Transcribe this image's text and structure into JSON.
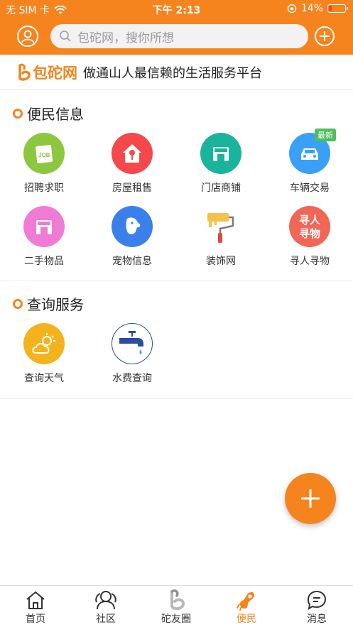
{
  "status": {
    "carrier": "无 SIM 卡",
    "time": "下午 2:13",
    "battery": "14%"
  },
  "search": {
    "placeholder": "包砣网，搜你所想"
  },
  "banner": {
    "logo": "包砣网",
    "tagline": "做通山人最信赖的生活服务平台"
  },
  "sections": {
    "convenience": {
      "title": "便民信息",
      "items": [
        {
          "label": "招聘求职",
          "icon": "job-icon",
          "color": "#8dc63f"
        },
        {
          "label": "房屋租售",
          "icon": "house-icon",
          "color": "#f5484a"
        },
        {
          "label": "门店商铺",
          "icon": "store-icon",
          "color": "#1ab39b"
        },
        {
          "label": "车辆交易",
          "icon": "car-icon",
          "color": "#3aa0f5",
          "badge": "最新"
        },
        {
          "label": "二手物品",
          "icon": "secondhand-icon",
          "color": "#f07bd4"
        },
        {
          "label": "宠物信息",
          "icon": "pet-icon",
          "color": "#3b80ea"
        },
        {
          "label": "装饰网",
          "icon": "paint-roller-icon",
          "color": "#ffffff"
        },
        {
          "label": "寻人寻物",
          "icon": "search-people-icon",
          "color": "#f26657",
          "text": "寻人\n寻物"
        }
      ]
    },
    "query": {
      "title": "查询服务",
      "items": [
        {
          "label": "查询天气",
          "icon": "weather-icon",
          "color": "#f4b21d"
        },
        {
          "label": "水费查询",
          "icon": "water-tap-icon",
          "color": "#ffffff"
        }
      ]
    }
  },
  "tabs": [
    {
      "label": "首页",
      "icon": "home-icon"
    },
    {
      "label": "社区",
      "icon": "community-icon"
    },
    {
      "label": "砣友圈",
      "icon": "friends-circle-icon"
    },
    {
      "label": "便民",
      "icon": "convenience-icon",
      "active": true
    },
    {
      "label": "消息",
      "icon": "message-icon"
    }
  ],
  "colors": {
    "brand": "#f5841f",
    "active_tab": "#f5841f"
  }
}
